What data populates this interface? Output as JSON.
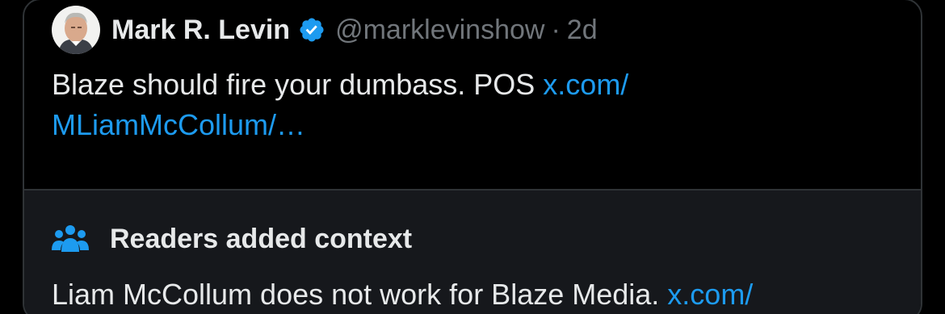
{
  "tweet": {
    "author_name": "Mark R. Levin",
    "handle": "@marklevinshow",
    "separator": "·",
    "time": "2d",
    "text": "Blaze should fire your dumbass.  POS ",
    "link_part1": "x.com/",
    "link_part2": "MLiamMcCollum/…"
  },
  "community_note": {
    "title": "Readers added context",
    "text": "Liam McCollum does not work for Blaze Media. ",
    "link": "x.com/"
  },
  "icons": {
    "verified": "verified-badge-icon",
    "context": "people-icon"
  },
  "colors": {
    "background": "#000000",
    "note_background": "#16181c",
    "link": "#1d9bf0",
    "muted": "#71767b",
    "text": "#e7e9ea"
  }
}
